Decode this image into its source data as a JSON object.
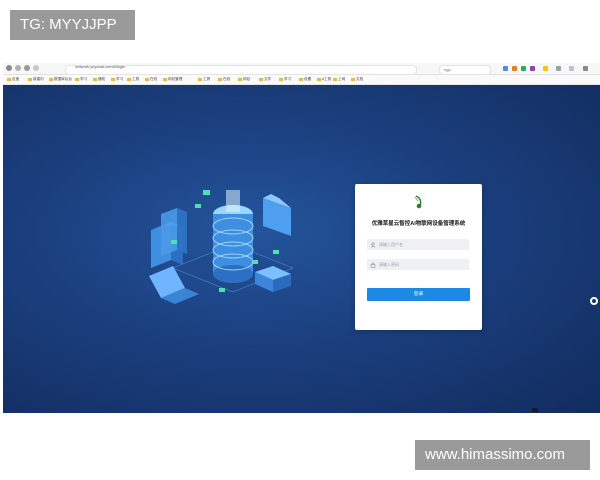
{
  "watermarks": {
    "top": "TG: MYYJJPP",
    "bottom": "www.himassimo.com"
  },
  "browser": {
    "url": "network.yuyaoai.com/#/login",
    "search_text": "ngp",
    "bookmarks": [
      "百度",
      "新建内",
      "数据库后台",
      "学习",
      "通知",
      "学习",
      "工具",
      "在线",
      "网站管理",
      "工具",
      "在线",
      "网站",
      "文件",
      "学习",
      "设置",
      "a工具",
      "上网",
      "文档"
    ]
  },
  "login": {
    "title": "优雅草星云智控AI物联网设备管理系统",
    "username_placeholder": "请输入用户名",
    "password_placeholder": "请输入密码",
    "login_button": "登录"
  },
  "colors": {
    "accent": "#1e88e5",
    "background": "#1b3f7e",
    "card": "#ffffff"
  },
  "icons": [
    "user-icon",
    "lock-icon",
    "leaf-logo-icon"
  ]
}
